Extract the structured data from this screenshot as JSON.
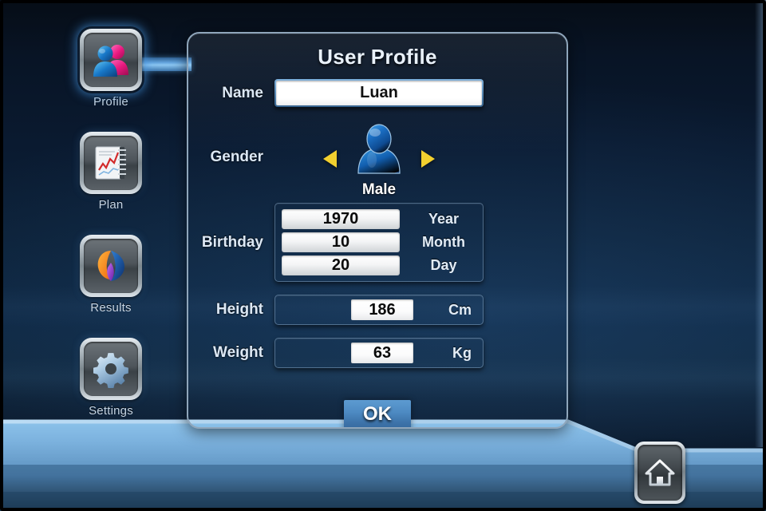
{
  "app": {
    "screen_title": "User Profile"
  },
  "sidebar": {
    "items": [
      {
        "label": "Profile",
        "icon": "two-people-icon",
        "active": true
      },
      {
        "label": "Plan",
        "icon": "notebook-chart-icon",
        "active": false
      },
      {
        "label": "Results",
        "icon": "pie-chart-icon",
        "active": false
      },
      {
        "label": "Settings",
        "icon": "gear-icon",
        "active": false
      }
    ]
  },
  "form": {
    "name": {
      "label": "Name",
      "value": "Luan"
    },
    "gender": {
      "label": "Gender",
      "value": "Male",
      "prev_icon": "left-arrow-icon",
      "next_icon": "right-arrow-icon"
    },
    "birthday": {
      "label": "Birthday",
      "year": {
        "value": "1970",
        "unit": "Year"
      },
      "month": {
        "value": "10",
        "unit": "Month"
      },
      "day": {
        "value": "20",
        "unit": "Day"
      }
    },
    "height": {
      "label": "Height",
      "value": "186",
      "unit": "Cm"
    },
    "weight": {
      "label": "Weight",
      "value": "63",
      "unit": "Kg"
    },
    "submit": {
      "label": "OK"
    }
  },
  "home_button": {
    "icon": "home-icon"
  },
  "colors": {
    "accent_blue": "#4d8ac2",
    "arrow_yellow": "#f2d02f",
    "panel_border": "#8fa6bb",
    "label_text": "#dce8f5",
    "bottom_bar": "#7fb4e0"
  }
}
